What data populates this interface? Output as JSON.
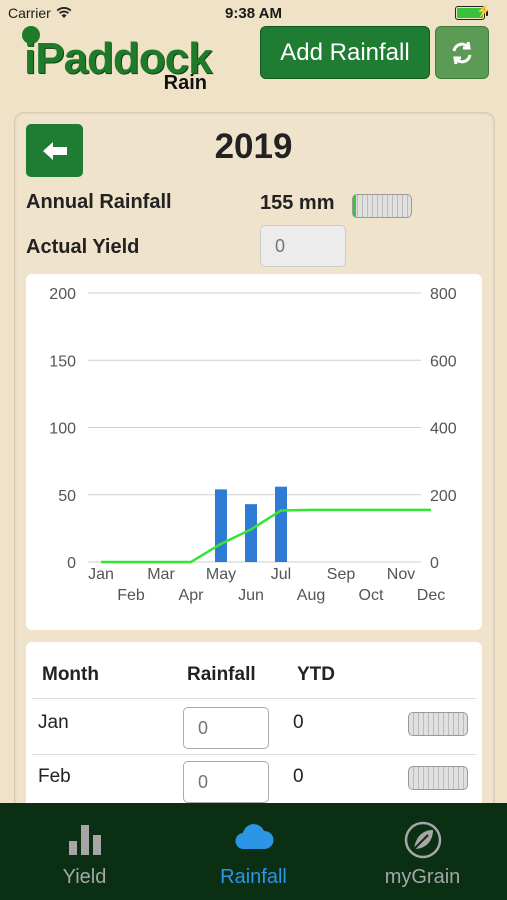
{
  "status_bar": {
    "carrier": "Carrier",
    "time": "9:38 AM"
  },
  "header": {
    "logo_main": "iPaddock",
    "logo_sub": "Rain",
    "add_rainfall_label": "Add Rainfall"
  },
  "year": "2019",
  "annual_rainfall": {
    "label": "Annual Rainfall",
    "value": "155 mm",
    "gauge_fraction": 0.05
  },
  "actual_yield": {
    "label": "Actual Yield",
    "placeholder": "0"
  },
  "chart_data": {
    "type": "bar",
    "categories": [
      "Jan",
      "Feb",
      "Mar",
      "Apr",
      "May",
      "Jun",
      "Jul",
      "Aug",
      "Sep",
      "Oct",
      "Nov",
      "Dec"
    ],
    "series": [
      {
        "type": "bar",
        "axis": "left",
        "values": [
          0,
          0,
          0,
          0,
          54,
          43,
          56,
          0,
          0,
          0,
          0,
          0
        ]
      },
      {
        "type": "line",
        "axis": "right",
        "values": [
          0,
          0,
          0,
          0,
          54,
          97,
          153,
          155,
          155,
          155,
          155,
          155
        ]
      }
    ],
    "left_axis": {
      "ticks": [
        0,
        50,
        100,
        150,
        200
      ],
      "ylim": [
        0,
        200
      ]
    },
    "right_axis": {
      "ticks": [
        0,
        200,
        400,
        600,
        800
      ],
      "ylim": [
        0,
        800
      ]
    },
    "grid": true,
    "colors": {
      "bar": "#2e7bd6",
      "line": "#34e634"
    }
  },
  "table": {
    "headers": {
      "month": "Month",
      "rainfall": "Rainfall",
      "ytd": "YTD"
    },
    "rows": [
      {
        "month": "Jan",
        "rainfall_placeholder": "0",
        "ytd": "0",
        "gauge_fraction": 0
      },
      {
        "month": "Feb",
        "rainfall_placeholder": "0",
        "ytd": "0",
        "gauge_fraction": 0
      }
    ]
  },
  "tabs": [
    {
      "label": "Yield",
      "icon": "bar-chart-icon",
      "active": false
    },
    {
      "label": "Rainfall",
      "icon": "cloud-icon",
      "active": true
    },
    {
      "label": "myGrain",
      "icon": "leaf-icon",
      "active": false
    }
  ],
  "colors": {
    "accent_green": "#1f7c33",
    "active_tab": "#2b95e6",
    "tab_bar": "#0b2f12"
  }
}
